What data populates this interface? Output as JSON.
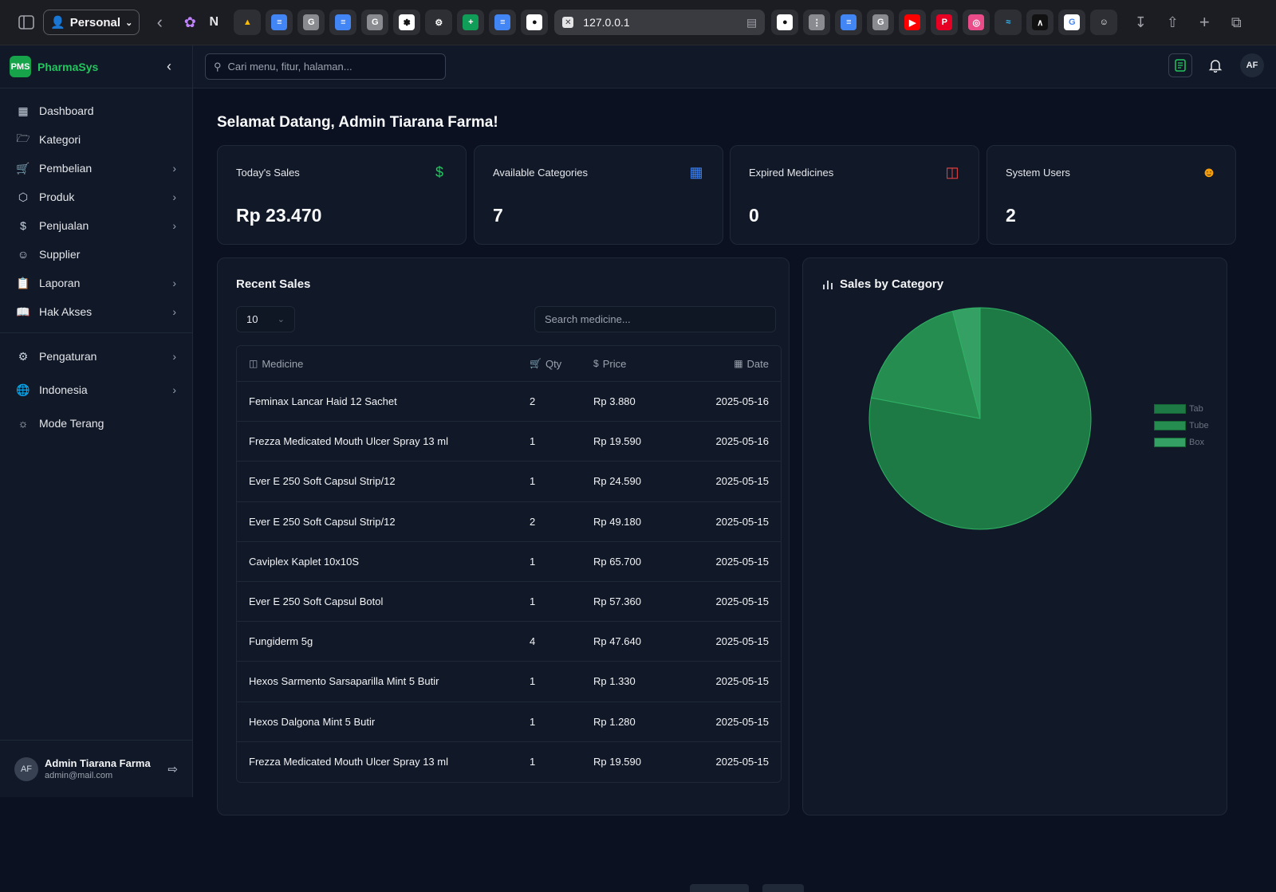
{
  "browser": {
    "profile_label": "Personal",
    "url": "127.0.0.1",
    "tabs_left": [
      "drive",
      "docs",
      "g",
      "docs",
      "g",
      "slack",
      "openai",
      "sheets",
      "docs",
      "github"
    ],
    "tabs_right": [
      "github",
      "dots",
      "docs",
      "g",
      "youtube",
      "pinterest",
      "dribbble",
      "tailwind",
      "vercel",
      "google",
      "user"
    ]
  },
  "app": {
    "logo_text": "PMS",
    "name": "PharmaSys",
    "search_placeholder": "Cari menu, fitur, halaman...",
    "avatar_initials": "AF"
  },
  "sidebar": {
    "items": [
      {
        "label": "Dashboard",
        "icon": "grid-icon",
        "chevron": false
      },
      {
        "label": "Kategori",
        "icon": "folder-icon",
        "chevron": false
      },
      {
        "label": "Pembelian",
        "icon": "cart-icon",
        "chevron": true
      },
      {
        "label": "Produk",
        "icon": "box-icon",
        "chevron": true
      },
      {
        "label": "Penjualan",
        "icon": "dollar-icon",
        "chevron": true
      },
      {
        "label": "Supplier",
        "icon": "user-icon",
        "chevron": false
      },
      {
        "label": "Laporan",
        "icon": "clipboard-icon",
        "chevron": true
      },
      {
        "label": "Hak Akses",
        "icon": "book-icon",
        "chevron": true
      }
    ],
    "settings": [
      {
        "label": "Pengaturan",
        "icon": "gear-icon",
        "chevron": true
      },
      {
        "label": "Indonesia",
        "icon": "globe-icon",
        "chevron": true
      },
      {
        "label": "Mode Terang",
        "icon": "sun-icon",
        "chevron": false
      }
    ],
    "user": {
      "initials": "AF",
      "name": "Admin Tiarana Farma",
      "email": "admin@mail.com"
    }
  },
  "main": {
    "welcome": "Selamat Datang, Admin Tiarana Farma!",
    "cards": [
      {
        "title": "Today's Sales",
        "value": "Rp 23.470",
        "icon": "dollar-icon",
        "color": "#22c55e"
      },
      {
        "title": "Available Categories",
        "value": "7",
        "icon": "grid-icon",
        "color": "#3b82f6"
      },
      {
        "title": "Expired Medicines",
        "value": "0",
        "icon": "archive-icon",
        "color": "#ef4444"
      },
      {
        "title": "System Users",
        "value": "2",
        "icon": "users-icon",
        "color": "#f59e0b"
      }
    ],
    "recent_sales": {
      "title": "Recent Sales",
      "per_page": "10",
      "search_placeholder": "Search medicine...",
      "headers": {
        "medicine": "Medicine",
        "qty": "Qty",
        "price": "Price",
        "date": "Date"
      },
      "rows": [
        {
          "medicine": "Feminax Lancar Haid 12 Sachet",
          "qty": "2",
          "price": "Rp 3.880",
          "date": "2025-05-16"
        },
        {
          "medicine": "Frezza Medicated Mouth Ulcer Spray 13 ml",
          "qty": "1",
          "price": "Rp 19.590",
          "date": "2025-05-16"
        },
        {
          "medicine": "Ever E 250 Soft Capsul Strip/12",
          "qty": "1",
          "price": "Rp 24.590",
          "date": "2025-05-15"
        },
        {
          "medicine": "Ever E 250 Soft Capsul Strip/12",
          "qty": "2",
          "price": "Rp 49.180",
          "date": "2025-05-15"
        },
        {
          "medicine": "Caviplex Kaplet 10x10S",
          "qty": "1",
          "price": "Rp 65.700",
          "date": "2025-05-15"
        },
        {
          "medicine": "Ever E 250 Soft Capsul Botol",
          "qty": "1",
          "price": "Rp 57.360",
          "date": "2025-05-15"
        },
        {
          "medicine": "Fungiderm 5g",
          "qty": "4",
          "price": "Rp 47.640",
          "date": "2025-05-15"
        },
        {
          "medicine": "Hexos Sarmento Sarsaparilla Mint 5 Butir",
          "qty": "1",
          "price": "Rp 1.330",
          "date": "2025-05-15"
        },
        {
          "medicine": "Hexos Dalgona Mint 5 Butir",
          "qty": "1",
          "price": "Rp 1.280",
          "date": "2025-05-15"
        },
        {
          "medicine": "Frezza Medicated Mouth Ulcer Spray 13 ml",
          "qty": "1",
          "price": "Rp 19.590",
          "date": "2025-05-15"
        }
      ]
    },
    "sales_by_category": {
      "title": "Sales by Category"
    }
  },
  "chart_data": {
    "type": "pie",
    "title": "Sales by Category",
    "categories": [
      "Tab",
      "Tube",
      "Box"
    ],
    "values": [
      78,
      18,
      4
    ],
    "colors": [
      "#1e7a45",
      "#258d50",
      "#34a063"
    ],
    "legend_position": "right"
  },
  "colors": {
    "accent": "#22c55e",
    "background": "#0b1120",
    "panel": "#111827"
  }
}
